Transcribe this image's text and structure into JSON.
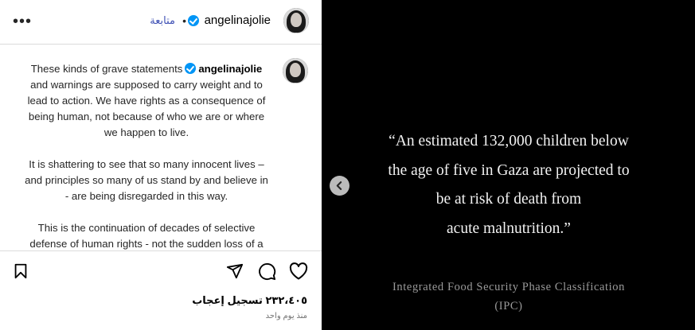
{
  "header": {
    "more_label": "•••",
    "username": "angelinajolie",
    "separator": "•",
    "follow_label": "متابعة"
  },
  "caption": {
    "paragraphs": [
      "These kinds of grave statements",
      "and warnings are supposed to carry weight and to lead to action. We have rights as a consequence of being human, not because of who we are or where we happen to live.",
      "It is shattering to see that so many innocent lives – and principles so many of us stand by and believe in - are being disregarded in this way.",
      "This is the continuation of decades of selective defense of human rights - not the sudden loss of a moral center. It is the consequence of treating"
    ],
    "username": "angelinajolie"
  },
  "actions": {
    "like_icon": "heart-icon",
    "comment_icon": "comment-icon",
    "share_icon": "send-icon",
    "save_icon": "bookmark-icon"
  },
  "likes_text": "٢٣٢،٤٠٥ تسجيل إعجاب",
  "time_text": "منذ يوم واحد",
  "media": {
    "quote_lines": [
      "“An estimated 132,000 children below",
      "the age of five in Gaza are projected to",
      "be at risk of death from",
      "acute malnutrition.”"
    ],
    "source_lines": [
      "Integrated Food Security Phase Classification",
      "(IPC)"
    ],
    "prev_icon": "chevron-left-icon"
  },
  "colors": {
    "verified": "#0095f6",
    "follow": "#3f51b5",
    "media_bg": "#000000"
  }
}
